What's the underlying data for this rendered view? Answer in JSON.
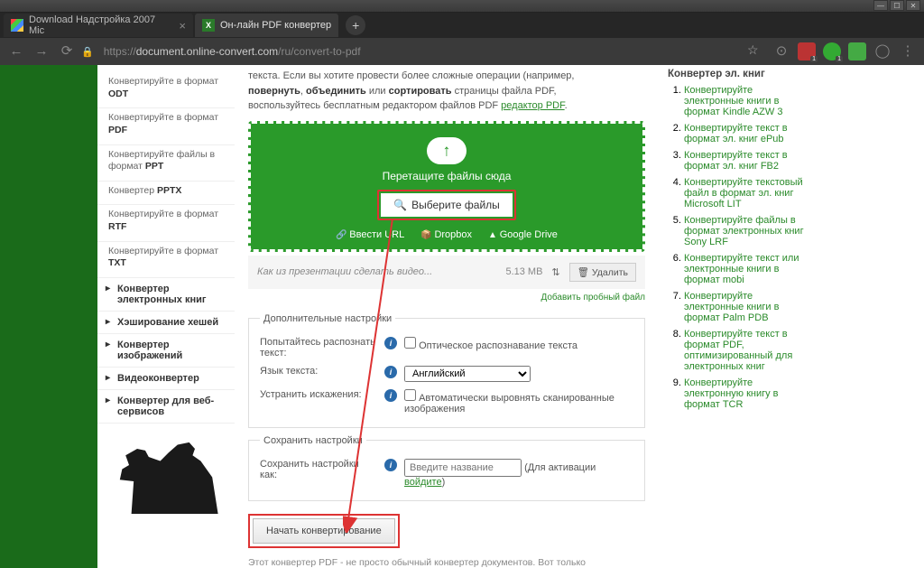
{
  "window": {
    "min": "—",
    "max": "☐",
    "close": "✕"
  },
  "tabs": {
    "t1": "Download Надстройка 2007 Mic",
    "t2": "Он-лайн PDF конвертер",
    "oc": "X"
  },
  "url": {
    "scheme": "https://",
    "host": "document.online-convert.com",
    "path": "/ru/convert-to-pdf"
  },
  "ext": {
    "b1": "1"
  },
  "sidebar": {
    "i1a": "Конвертируйте в формат",
    "i1b": "ODT",
    "i2a": "Конвертируйте в формат",
    "i2b": "PDF",
    "i3a": "Конвертируйте файлы в формат",
    "i3b": "PPT",
    "i4a": "Конвертер",
    "i4b": "PPTX",
    "i5a": "Конвертируйте в формат",
    "i5b": "RTF",
    "i6a": "Конвертируйте в формат",
    "i6b": "TXT",
    "c1": "Конвертер электронных книг",
    "c2": "Хэширование хешей",
    "c3": "Конвертер изображений",
    "c4": "Видеоконвертер",
    "c5": "Конвертер для веб-сервисов"
  },
  "intro": {
    "l1": "текста. Если вы хотите провести более сложные операции (например,",
    "b1": "повернуть",
    "s1": ", ",
    "b2": "объединить",
    "s2": " или ",
    "b3": "сортировать",
    "s3": " страницы файла PDF,",
    "l2": "воспользуйтесь бесплатным редактором файлов PDF ",
    "a1": "редактор PDF",
    "dot": "."
  },
  "drop": {
    "txt": "Перетащите файлы сюда",
    "btn": "Выберите файлы",
    "s1": "Ввести URL",
    "s2": "Dropbox",
    "s3": "Google Drive"
  },
  "file": {
    "name": "Как из презентации сделать видео...",
    "size": "5.13 MB",
    "act": "⇅",
    "del": "Удалить",
    "trash": "🗑"
  },
  "add": "Добавить пробный файл",
  "fset1": {
    "legend": "Дополнительные настройки",
    "r1": "Попытайтесь распознать текст:",
    "r1b": "Оптическое распознавание текста",
    "r2": "Язык текста:",
    "r2v": "Английский",
    "r3": "Устранить искажения:",
    "r3b": "Автоматически выровнять сканированные изображения"
  },
  "fset2": {
    "legend": "Сохранить настройки",
    "r1": "Сохранить настройки как:",
    "ph": "Введите название",
    "note": "(Для активации ",
    "link": "войдите",
    "note2": ")"
  },
  "start": "Начать конвертирование",
  "foot": "Этот конвертер PDF - не просто обычный конвертер документов. Вот только",
  "right": {
    "title": "Конвертер эл. книг",
    "l1": "Конвертируйте электронные книги в формат Kindle AZW 3",
    "l2": "Конвертируйте текст в формат эл. книг ePub",
    "l3": "Конвертируйте текст в формат эл. книг FB2",
    "l4": "Конвертируйте текстовый файл в формат эл. книг Microsoft LIT",
    "l5": "Конвертируйте файлы в формат электронных книг Sony LRF",
    "l6": "Конвертируйте текст или электронные книги в формат mobi",
    "l7": "Конвертируйте электронные книги в формат Palm PDB",
    "l8": "Конвертируйте текст в формат PDF, оптимизированный для электронных книг",
    "l9": "Конвертируйте электронную книгу в формат TCR"
  }
}
